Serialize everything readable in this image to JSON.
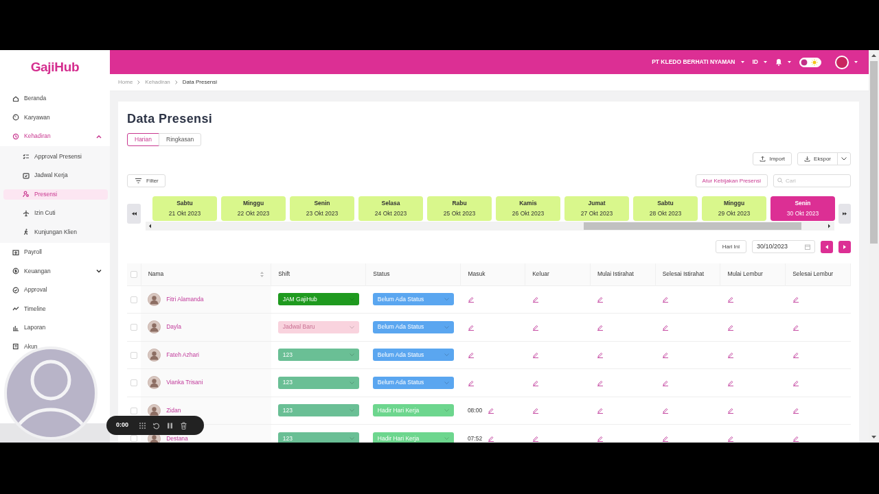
{
  "topbar": {
    "company": "PT KLEDO BERHATI NYAMAN",
    "language": "ID",
    "dark_mode": false
  },
  "sidebar": {
    "logo": "GajiHub",
    "items": [
      {
        "label": "Beranda",
        "selected": false
      },
      {
        "label": "Karyawan",
        "selected": false
      },
      {
        "label": "Kehadiran",
        "selected": true,
        "expanded": true,
        "children": [
          {
            "label": "Approval Presensi",
            "selected": false
          },
          {
            "label": "Jadwal Kerja",
            "selected": false
          },
          {
            "label": "Presensi",
            "selected": true
          },
          {
            "label": "Izin Cuti",
            "selected": false
          },
          {
            "label": "Kunjungan Klien",
            "selected": false
          }
        ]
      },
      {
        "label": "Payroll",
        "selected": false
      },
      {
        "label": "Keuangan",
        "selected": false,
        "expanded": false
      },
      {
        "label": "Approval",
        "selected": false
      },
      {
        "label": "Timeline",
        "selected": false
      },
      {
        "label": "Laporan",
        "selected": false
      },
      {
        "label": "Akun",
        "selected": false
      }
    ]
  },
  "breadcrumb": [
    "Home",
    "Kehadiran",
    "Data Presensi"
  ],
  "page": {
    "title": "Data Presensi",
    "view_tabs": [
      {
        "label": "Harian",
        "selected": true
      },
      {
        "label": "Ringkasan",
        "selected": false
      }
    ],
    "import_button": "Import",
    "export_button": "Ekspor",
    "filter_button": "Filter",
    "policy_button": "Atur Kebijakan Presensi",
    "search": {
      "placeholder": "Cari"
    },
    "days": [
      {
        "day": "Sabtu",
        "date": "21 Okt 2023",
        "selected": false
      },
      {
        "day": "Minggu",
        "date": "22 Okt 2023",
        "selected": false
      },
      {
        "day": "Senin",
        "date": "23 Okt 2023",
        "selected": false
      },
      {
        "day": "Selasa",
        "date": "24 Okt 2023",
        "selected": false
      },
      {
        "day": "Rabu",
        "date": "25 Okt 2023",
        "selected": false
      },
      {
        "day": "Kamis",
        "date": "26 Okt 2023",
        "selected": false
      },
      {
        "day": "Jumat",
        "date": "27 Okt 2023",
        "selected": false
      },
      {
        "day": "Sabtu",
        "date": "28 Okt 2023",
        "selected": false
      },
      {
        "day": "Minggu",
        "date": "29 Okt 2023",
        "selected": false
      },
      {
        "day": "Senin",
        "date": "30 Okt 2023",
        "selected": true
      }
    ],
    "today_button": "Hari Ini",
    "date_field": {
      "value": "30/10/2023"
    }
  },
  "table": {
    "all_checked": false,
    "columns": [
      "Nama",
      "Shift",
      "Status",
      "Masuk",
      "Keluar",
      "Mulai Istirahat",
      "Selesai Istirahat",
      "Mulai Lembur",
      "Selesai Lembur"
    ],
    "rows": [
      {
        "checked": false,
        "name": "Fitri Alamanda",
        "shift": {
          "label": "JAM GajiHub",
          "color": "#1f9a1f"
        },
        "status": {
          "label": "Belum Ada Status",
          "color": "#5aa6f0"
        }
      },
      {
        "checked": false,
        "name": "Dayla",
        "shift": {
          "label": "Jadwal Baru",
          "color": "#f9d3de"
        },
        "status": {
          "label": "Belum Ada Status",
          "color": "#5aa6f0"
        }
      },
      {
        "checked": false,
        "name": "Fateh Azhari",
        "shift": {
          "label": "123",
          "color": "#6abf95"
        },
        "status": {
          "label": "Belum Ada Status",
          "color": "#5aa6f0"
        }
      },
      {
        "checked": false,
        "name": "Vianka Trisani",
        "shift": {
          "label": "123",
          "color": "#6abf95"
        },
        "status": {
          "label": "Belum Ada Status",
          "color": "#5aa6f0"
        }
      },
      {
        "checked": false,
        "name": "Zidan",
        "shift": {
          "label": "123",
          "color": "#6abf95"
        },
        "status": {
          "label": "Hadir Hari Kerja",
          "color": "#6dd68e"
        },
        "masuk": "08:00"
      },
      {
        "checked": false,
        "name": "Destana",
        "shift": {
          "label": "123",
          "color": "#6abf95"
        },
        "status": {
          "label": "Hadir Hari Kerja",
          "color": "#6dd68e"
        },
        "masuk": "07:52"
      }
    ]
  },
  "recorder": {
    "time": "0:00"
  }
}
